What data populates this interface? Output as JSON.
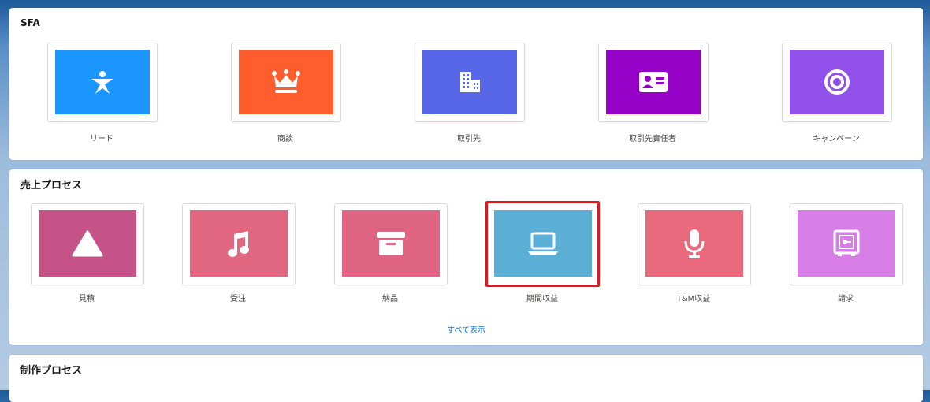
{
  "sections": {
    "sfa": {
      "title": "SFA",
      "tiles": [
        {
          "label": "リード",
          "color": "#1b96ff",
          "icon": "person-star-icon"
        },
        {
          "label": "商談",
          "color": "#ff5d2d",
          "icon": "crown-icon"
        },
        {
          "label": "取引先",
          "color": "#5867e8",
          "icon": "building-icon"
        },
        {
          "label": "取引先責任者",
          "color": "#9602c7",
          "icon": "contact-card-icon"
        },
        {
          "label": "キャンペーン",
          "color": "#9050e9",
          "icon": "target-icon"
        }
      ]
    },
    "sales_process": {
      "title": "売上プロセス",
      "tiles": [
        {
          "label": "見積",
          "color": "#c65388",
          "icon": "triangle-icon"
        },
        {
          "label": "受注",
          "color": "#e0677f",
          "icon": "music-note-icon"
        },
        {
          "label": "納品",
          "color": "#e06484",
          "icon": "archive-box-icon"
        },
        {
          "label": "期間収益",
          "color": "#5bafd4",
          "icon": "laptop-icon"
        },
        {
          "label": "T&M収益",
          "color": "#e9697c",
          "icon": "microphone-icon"
        },
        {
          "label": "請求",
          "color": "#d67ee6",
          "icon": "safe-icon"
        }
      ],
      "show_all": "すべて表示"
    },
    "production_process": {
      "title": "制作プロセス"
    }
  }
}
